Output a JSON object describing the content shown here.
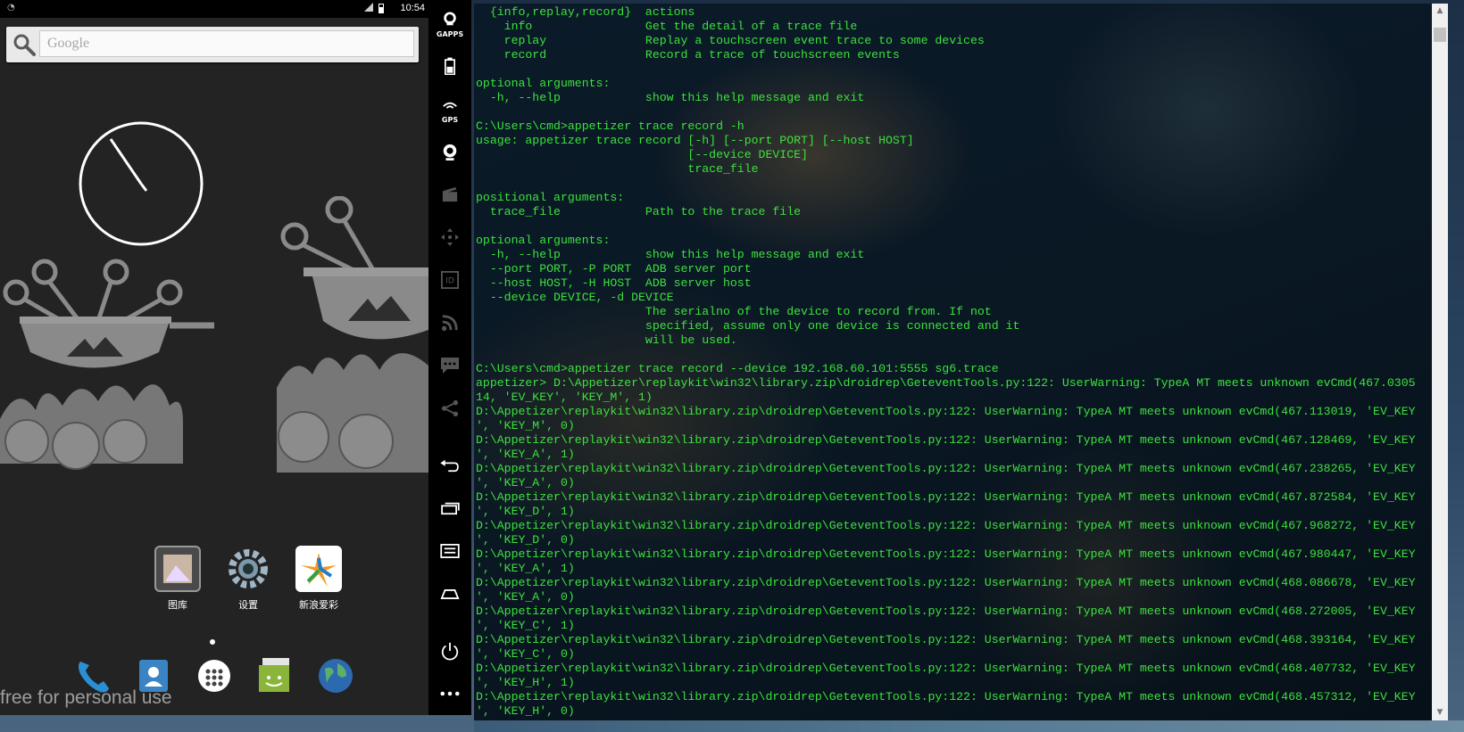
{
  "android": {
    "status_time": "10:54",
    "search_placeholder": "Google",
    "apps": [
      {
        "label": "图库",
        "icon": "gallery-icon"
      },
      {
        "label": "设置",
        "icon": "settings-gear-icon"
      },
      {
        "label": "新浪爱彩",
        "icon": "sina-lottery-icon"
      }
    ],
    "dock": [
      {
        "icon": "phone-icon"
      },
      {
        "icon": "contacts-icon"
      },
      {
        "icon": "app-drawer-icon"
      },
      {
        "icon": "messaging-icon"
      },
      {
        "icon": "browser-globe-icon"
      }
    ],
    "watermark": "free for personal use"
  },
  "toolbar": {
    "gapps_label": "GAPPS",
    "gps_label": "GPS",
    "buttons": [
      "gapps-icon",
      "battery-icon",
      "gps-icon",
      "camera-icon",
      "clapper-icon",
      "dpad-icon",
      "device-id-icon",
      "rss-icon",
      "sms-icon",
      "share-icon",
      "back-icon",
      "recent-apps-icon",
      "menu-icon",
      "home-icon",
      "power-icon",
      "more-icon"
    ]
  },
  "colors": {
    "console_text": "#3ce23c",
    "android_bg": "#232323"
  },
  "console": {
    "lines": [
      "  {info,replay,record}  actions",
      "    info                Get the detail of a trace file",
      "    replay              Replay a touchscreen event trace to some devices",
      "    record              Record a trace of touchscreen events",
      "",
      "optional arguments:",
      "  -h, --help            show this help message and exit",
      "",
      "C:\\Users\\cmd>appetizer trace record -h",
      "usage: appetizer trace record [-h] [--port PORT] [--host HOST]",
      "                              [--device DEVICE]",
      "                              trace_file",
      "",
      "positional arguments:",
      "  trace_file            Path to the trace file",
      "",
      "optional arguments:",
      "  -h, --help            show this help message and exit",
      "  --port PORT, -P PORT  ADB server port",
      "  --host HOST, -H HOST  ADB server host",
      "  --device DEVICE, -d DEVICE",
      "                        The serialno of the device to record from. If not",
      "                        specified, assume only one device is connected and it",
      "                        will be used.",
      "",
      "C:\\Users\\cmd>appetizer trace record --device 192.168.60.101:5555 sg6.trace",
      "appetizer> D:\\Appetizer\\replaykit\\win32\\library.zip\\droidrep\\GeteventTools.py:122: UserWarning: TypeA MT meets unknown evCmd(467.0305",
      "14, 'EV_KEY', 'KEY_M', 1)",
      "D:\\Appetizer\\replaykit\\win32\\library.zip\\droidrep\\GeteventTools.py:122: UserWarning: TypeA MT meets unknown evCmd(467.113019, 'EV_KEY",
      "', 'KEY_M', 0)",
      "D:\\Appetizer\\replaykit\\win32\\library.zip\\droidrep\\GeteventTools.py:122: UserWarning: TypeA MT meets unknown evCmd(467.128469, 'EV_KEY",
      "', 'KEY_A', 1)",
      "D:\\Appetizer\\replaykit\\win32\\library.zip\\droidrep\\GeteventTools.py:122: UserWarning: TypeA MT meets unknown evCmd(467.238265, 'EV_KEY",
      "', 'KEY_A', 0)",
      "D:\\Appetizer\\replaykit\\win32\\library.zip\\droidrep\\GeteventTools.py:122: UserWarning: TypeA MT meets unknown evCmd(467.872584, 'EV_KEY",
      "', 'KEY_D', 1)",
      "D:\\Appetizer\\replaykit\\win32\\library.zip\\droidrep\\GeteventTools.py:122: UserWarning: TypeA MT meets unknown evCmd(467.968272, 'EV_KEY",
      "', 'KEY_D', 0)",
      "D:\\Appetizer\\replaykit\\win32\\library.zip\\droidrep\\GeteventTools.py:122: UserWarning: TypeA MT meets unknown evCmd(467.980447, 'EV_KEY",
      "', 'KEY_A', 1)",
      "D:\\Appetizer\\replaykit\\win32\\library.zip\\droidrep\\GeteventTools.py:122: UserWarning: TypeA MT meets unknown evCmd(468.086678, 'EV_KEY",
      "', 'KEY_A', 0)",
      "D:\\Appetizer\\replaykit\\win32\\library.zip\\droidrep\\GeteventTools.py:122: UserWarning: TypeA MT meets unknown evCmd(468.272005, 'EV_KEY",
      "', 'KEY_C', 1)",
      "D:\\Appetizer\\replaykit\\win32\\library.zip\\droidrep\\GeteventTools.py:122: UserWarning: TypeA MT meets unknown evCmd(468.393164, 'EV_KEY",
      "', 'KEY_C', 0)",
      "D:\\Appetizer\\replaykit\\win32\\library.zip\\droidrep\\GeteventTools.py:122: UserWarning: TypeA MT meets unknown evCmd(468.407732, 'EV_KEY",
      "', 'KEY_H', 1)",
      "D:\\Appetizer\\replaykit\\win32\\library.zip\\droidrep\\GeteventTools.py:122: UserWarning: TypeA MT meets unknown evCmd(468.457312, 'EV_KEY",
      "', 'KEY_H', 0)"
    ]
  }
}
